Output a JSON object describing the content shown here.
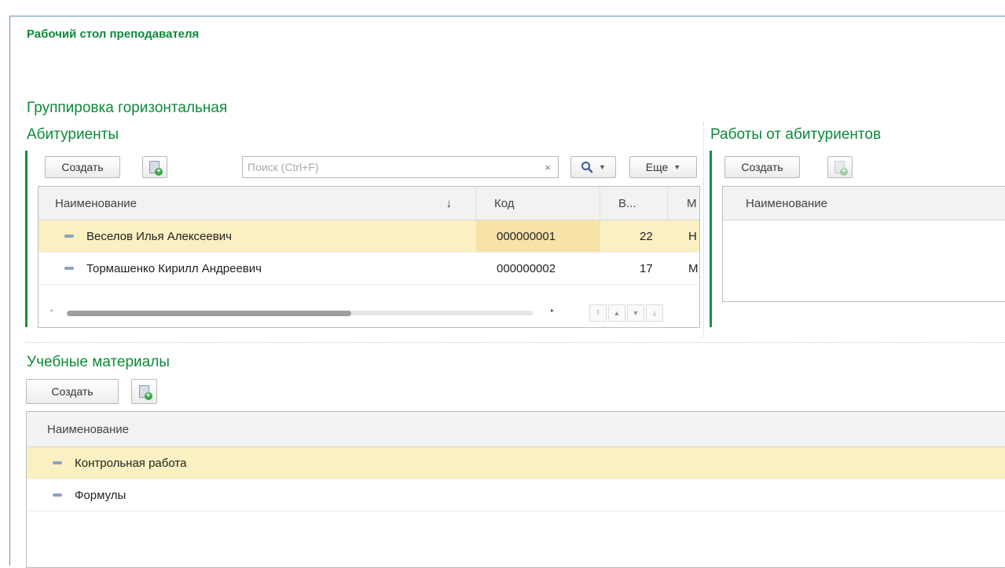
{
  "page": {
    "title": "Рабочий стол преподавателя"
  },
  "group": {
    "title": "Группировка горизонтальная"
  },
  "applicants": {
    "title": "Абитуриенты",
    "create_label": "Создать",
    "more_label": "Еще",
    "search": {
      "placeholder": "Поиск (Ctrl+F)",
      "clear": "×"
    },
    "columns": [
      "Наименование",
      "Код",
      "В...",
      "М"
    ],
    "sort_indicator": "↓",
    "rows": [
      {
        "name": "Веселов Илья Алексеевич",
        "code": "000000001",
        "age": "22",
        "m": "Н"
      },
      {
        "name": "Тормашенко Кирилл Андреевич",
        "code": "000000002",
        "age": "17",
        "m": "М"
      }
    ],
    "selected_row": 0
  },
  "works": {
    "title": "Работы от абитуриентов",
    "create_label": "Создать",
    "columns": [
      "Наименование"
    ]
  },
  "materials": {
    "title": "Учебные материалы",
    "create_label": "Создать",
    "columns": [
      "Наименование"
    ],
    "rows": [
      {
        "name": "Контрольная работа"
      },
      {
        "name": "Формулы"
      }
    ],
    "selected_row": 0
  },
  "colors": {
    "accent": "#0b8a3a",
    "selection": "#faf0c2",
    "border": "#bdbdbd"
  },
  "icons": [
    "add-copy-icon",
    "search-icon",
    "chevron-down-icon",
    "clear-icon",
    "first-page-icon",
    "prev-icon",
    "next-icon",
    "last-page-icon"
  ]
}
